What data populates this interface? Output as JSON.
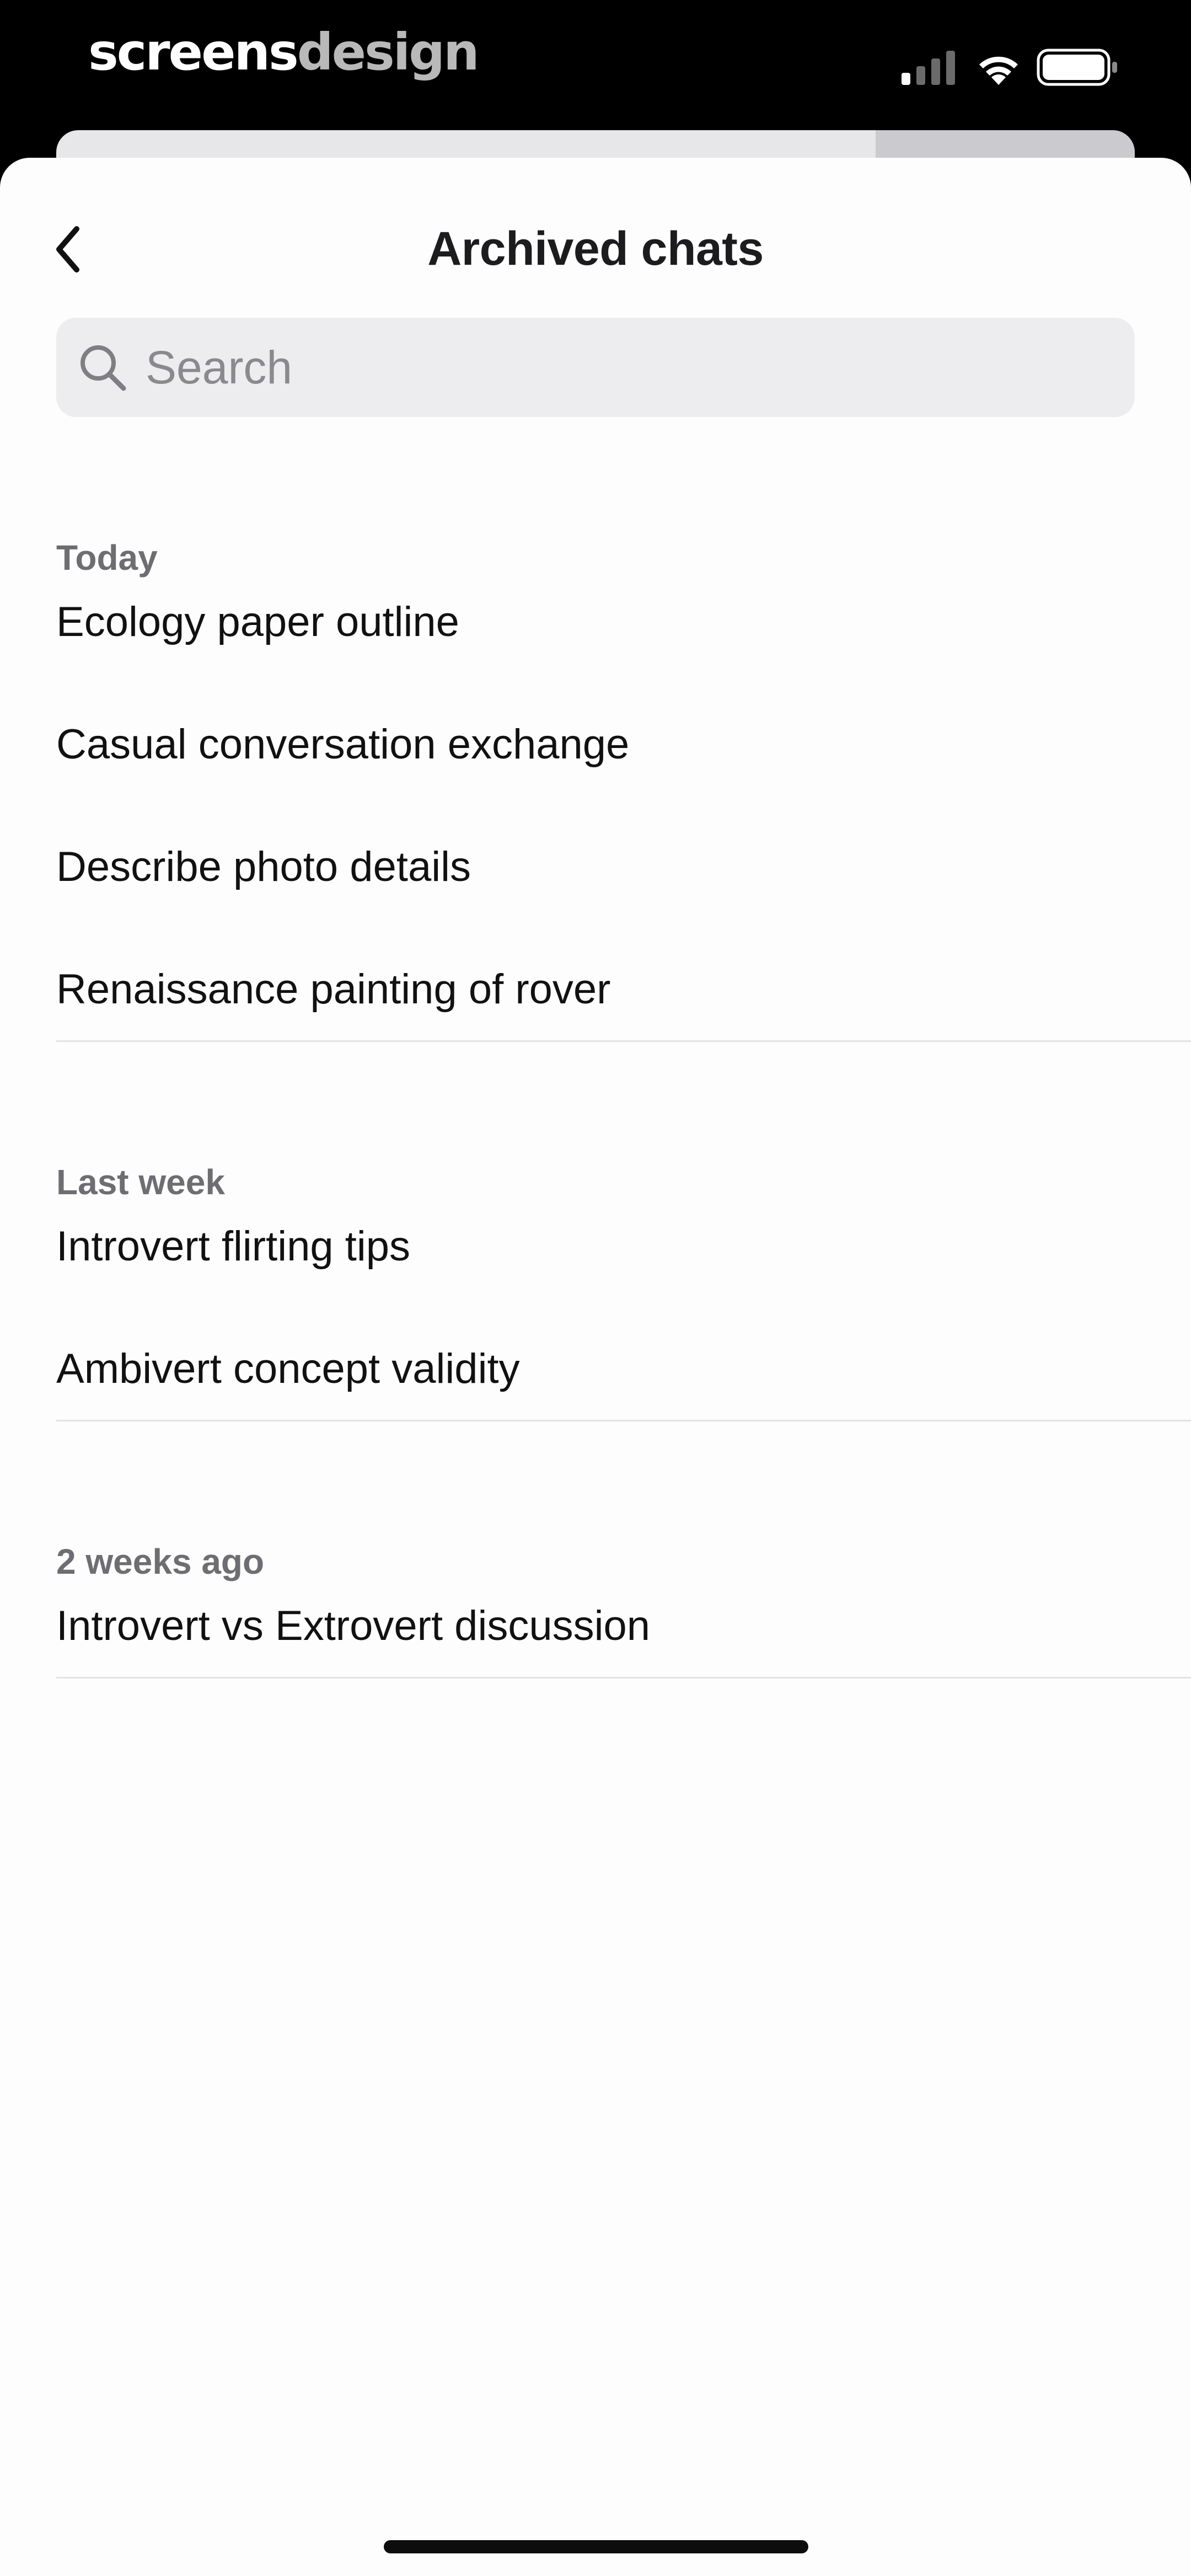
{
  "status_bar": {
    "brand_part1": "screens",
    "brand_part2": "design"
  },
  "header": {
    "title": "Archived chats"
  },
  "search": {
    "placeholder": "Search",
    "value": ""
  },
  "sections": [
    {
      "label": "Today",
      "chats": [
        "Ecology paper outline",
        "Casual conversation exchange",
        "Describe photo details",
        "Renaissance painting of rover"
      ]
    },
    {
      "label": "Last week",
      "chats": [
        "Introvert flirting tips",
        "Ambivert concept validity"
      ]
    },
    {
      "label": "2 weeks ago",
      "chats": [
        "Introvert vs Extrovert discussion"
      ]
    }
  ],
  "colors": {
    "background": "#fdfdfd",
    "search_bg": "#ededef",
    "section_label": "#6d6d72",
    "text": "#111111",
    "divider": "#e3e3e6"
  }
}
